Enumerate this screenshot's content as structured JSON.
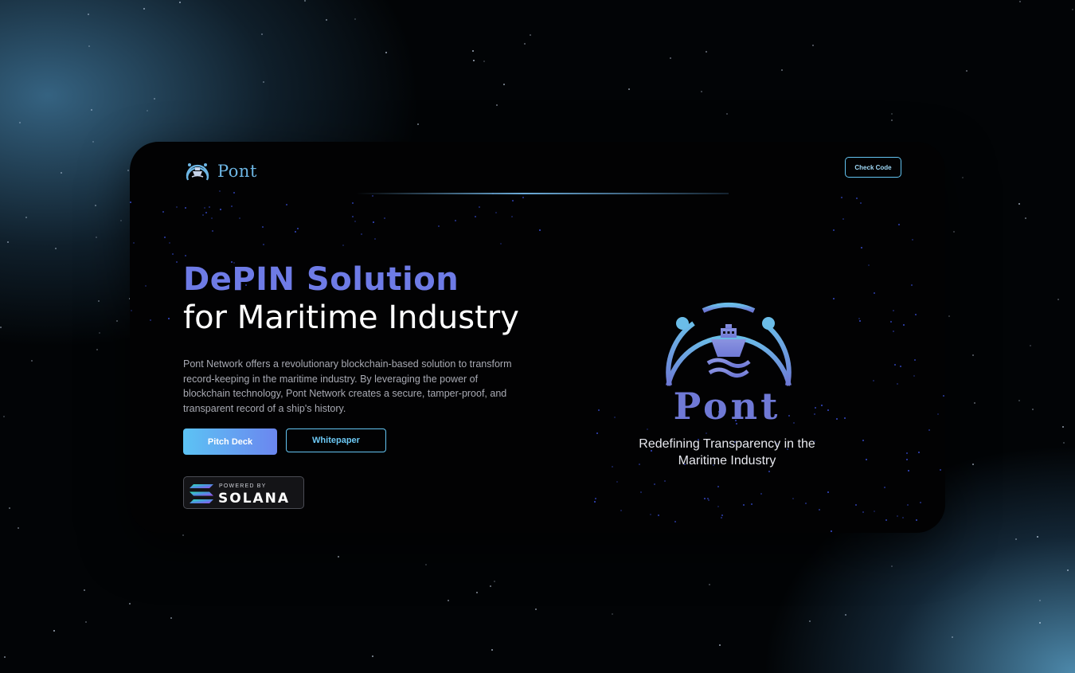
{
  "header": {
    "brand_name": "Pont",
    "check_code_label": "Check Code"
  },
  "hero": {
    "title": "DePIN Solution",
    "subtitle": "for Maritime Industry",
    "description": "Pont Network offers a revolutionary blockchain-based solution to transform record-keeping in the maritime industry. By leveraging the power of blockchain technology, Pont Network creates a secure, tamper-proof, and transparent record of a ship's history.",
    "pitch_deck_label": "Pitch Deck",
    "whitepaper_label": "Whitepaper"
  },
  "badge": {
    "powered_by": "POWERED BY",
    "name": "SOLANA"
  },
  "showcase": {
    "name": "Pont",
    "tagline_line1": "Redefining Transparency in the",
    "tagline_line2": "Maritime Industry"
  },
  "colors": {
    "accent_blue": "#63c4f2",
    "accent_purple": "#6e7be6",
    "card_background": "#020203"
  },
  "icons": {
    "brand_logo": "ship-in-arc-icon",
    "solana_logo": "solana-stripes-icon"
  }
}
